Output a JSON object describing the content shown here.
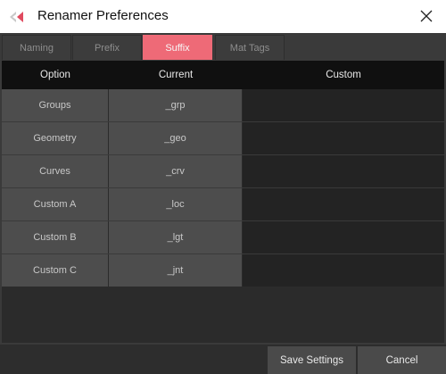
{
  "window": {
    "title": "Renamer Preferences"
  },
  "tabs": [
    {
      "label": "Naming"
    },
    {
      "label": "Prefix"
    },
    {
      "label": "Suffix",
      "active": true
    },
    {
      "label": "Mat Tags"
    }
  ],
  "table": {
    "columns": [
      "Option",
      "Current",
      "Custom"
    ],
    "rows": [
      {
        "option": "Groups",
        "current": "_grp",
        "custom": ""
      },
      {
        "option": "Geometry",
        "current": "_geo",
        "custom": ""
      },
      {
        "option": "Curves",
        "current": "_crv",
        "custom": ""
      },
      {
        "option": "Custom A",
        "current": "_loc",
        "custom": ""
      },
      {
        "option": "Custom B",
        "current": "_lgt",
        "custom": ""
      },
      {
        "option": "Custom C",
        "current": "_jnt",
        "custom": ""
      }
    ]
  },
  "footer": {
    "save_label": "Save Settings",
    "cancel_label": "Cancel"
  },
  "colors": {
    "accent": "#ee6a77",
    "background": "#3a3a3a",
    "header": "#101010"
  }
}
